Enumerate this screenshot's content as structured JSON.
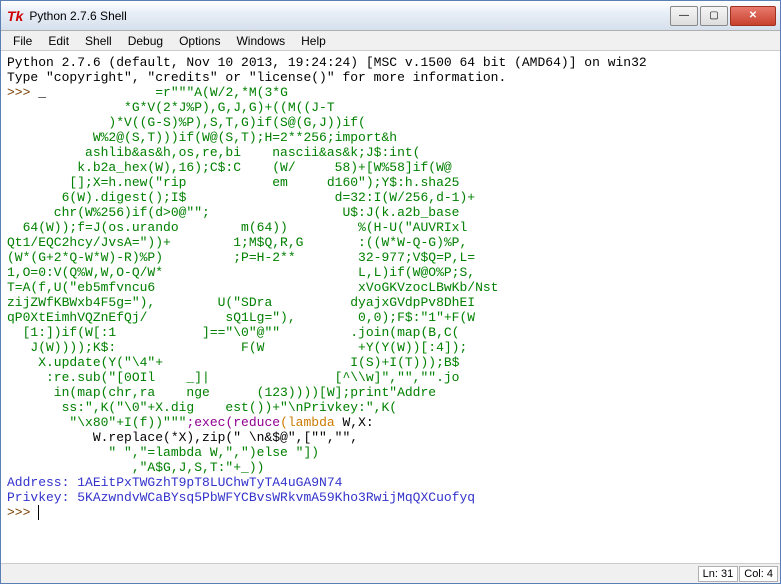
{
  "window": {
    "title": "Python 2.7.6 Shell"
  },
  "menu": {
    "items": [
      "File",
      "Edit",
      "Shell",
      "Debug",
      "Options",
      "Windows",
      "Help"
    ]
  },
  "header": {
    "line1": "Python 2.7.6 (default, Nov 10 2013, 19:24:24) [MSC v.1500 64 bit (AMD64)] on win32",
    "line2": "Type \"copyright\", \"credits\" or \"license()\" for more information."
  },
  "prompt": ">>> ",
  "prompt_tail": "_              ",
  "code_lines": [
    "=r\"\"\"A(W/2,*M(3*G",
    "               *G*V(2*J%P),G,J,G)+((M((J-T",
    "             )*V((G-S)%P),S,T,G)if(S@(G,J))if(",
    "           W%2@(S,T)))if(W@(S,T);H=2**256;import&h",
    "          ashlib&as&h,os,re,bi    nascii&as&k;J$:int(",
    "         k.b2a_hex(W),16);C$:C    (W/     58)+[W%58]if(W@",
    "        [];X=h.new(\"rip           em     d160\");Y$:h.sha25",
    "       6(W).digest();I$                   d=32:I(W/256,d-1)+",
    "      chr(W%256)if(d>0@\"\";                 U$:J(k.a2b_base",
    "  64(W));f=J(os.urando        m(64))         %(H-U(\"AUVRIxl",
    "Qt1/EQC2hcy/JvsA=\"))+        1;M$Q,R,G       :((W*W-Q-G)%P,",
    "(W*(G+2*Q-W*W)-R)%P)         ;P=H-2**        32-977;V$Q=P,L=",
    "1,O=0:V(Q%W,W,O-Q/W*                         L,L)if(W@O%P;S,",
    "T=A(f,U(\"eb5mfvncu6                          xVoGKVzocLBwKb/Nst",
    "zijZWfKBWxb4F5g=\"),        U(\"SDra          dyajxGVdpPv8DhEI",
    "qP0XtEimhVQZnEfQj/          sQ1Lg=\"),        0,0);F$:\"1\"+F(W",
    "  [1:])if(W[:1           ]==\"\\0\"@\"\"         .join(map(B,C(",
    "   J(W))));K$:                F(W            +Y(Y(W))[:4]);",
    "    X.update(Y(\"\\4\"+                        I(S)+I(T)));B$",
    "     :re.sub(\"[0OIl    _]|                [^\\\\w]\",\"\",\"\".jo",
    "      in(map(chr,ra    nge      (123))))[W];print\"Addre",
    "       ss:\",K(\"\\0\"+X.dig    est())+\"\\nPrivkey:\",K(",
    "        \"\\x80\"+I(f))\"\"\""
  ],
  "exec_part": ";exec(",
  "reduce_part": "reduce",
  "lambda_part": "(lambda",
  "lambda_tail": " W,X:",
  "tail_lines": [
    "           W.replace(*X),zip(\" \\n&$@\",[\"\",\"\",",
    "             \" \",\"=lambda W,\",\")else \"])",
    "                ,\"A$G,J,S,T:\"+_))"
  ],
  "output": {
    "address": "Address: 1AEitPxTWGzhT9pT8LUChwTyTA4uGA9N74",
    "privkey": "Privkey: 5KAzwndvWCaBYsq5PbWFYCBvsWRkvmA59Kho3RwijMqQXCuofyq"
  },
  "status": {
    "ln": "Ln: 31",
    "col": "Col: 4"
  }
}
